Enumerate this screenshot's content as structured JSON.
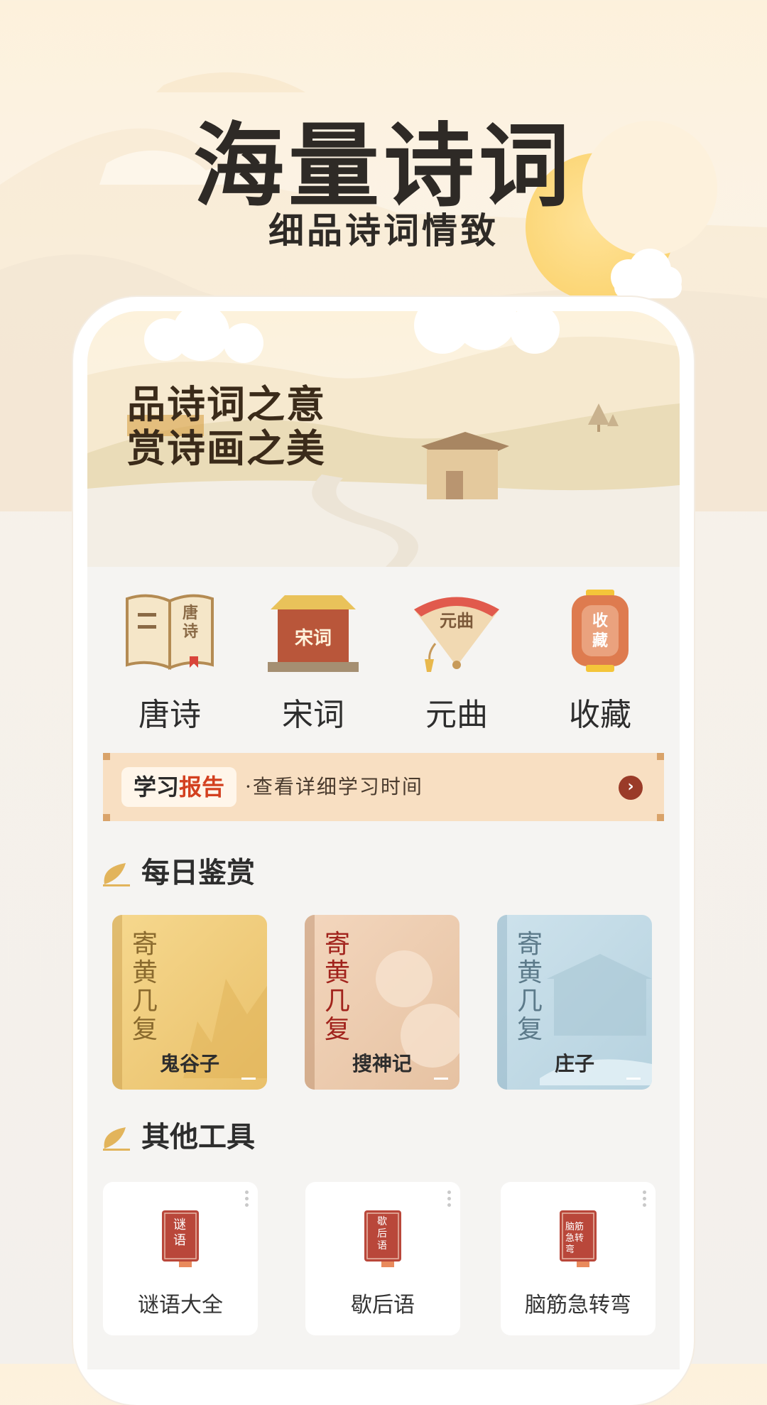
{
  "hero": {
    "title": "海量诗词",
    "subtitle": "细品诗词情致"
  },
  "banner": {
    "line1": "品诗词之意",
    "line2": "赏诗画之美"
  },
  "categories": [
    {
      "label": "唐诗",
      "icon_text": "唐诗",
      "icon": "book-icon"
    },
    {
      "label": "宋词",
      "icon_text": "宋词",
      "icon": "pavilion-icon"
    },
    {
      "label": "元曲",
      "icon_text": "元曲",
      "icon": "fan-icon"
    },
    {
      "label": "收藏",
      "icon_text": "收藏",
      "icon": "lantern-icon"
    }
  ],
  "report": {
    "tag_a": "学习",
    "tag_b": "报告",
    "desc": "·查看详细学习时间"
  },
  "daily": {
    "title": "每日鉴赏",
    "cards": [
      {
        "poem": "寄黄几复",
        "name": "鬼谷子"
      },
      {
        "poem": "寄黄几复",
        "name": "搜神记"
      },
      {
        "poem": "寄黄几复",
        "name": "庄子"
      }
    ]
  },
  "tools": {
    "title": "其他工具",
    "items": [
      {
        "label": "谜语大全",
        "book_text": "谜语"
      },
      {
        "label": "歇后语",
        "book_text": "歇后语"
      },
      {
        "label": "脑筋急转弯",
        "book_text": "脑筋急转弯"
      }
    ]
  },
  "colors": {
    "accent": "#d3401f",
    "banner_bg": "#f8dfc2",
    "text": "#2d2d2d"
  }
}
